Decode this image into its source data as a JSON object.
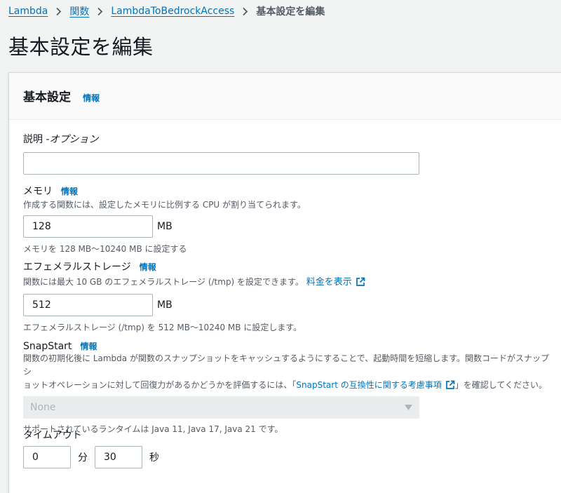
{
  "breadcrumb": {
    "items": [
      "Lambda",
      "関数",
      "LambdaToBedrockAccess"
    ],
    "current": "基本設定を編集"
  },
  "page_title": "基本設定を編集",
  "panel": {
    "title": "基本設定",
    "info": "情報"
  },
  "description_field": {
    "label": "説明 - ",
    "optional": "オプション",
    "value": ""
  },
  "memory": {
    "label": "メモリ",
    "info": "情報",
    "desc": "作成する関数には、設定したメモリに比例する CPU が割り当てられます。",
    "value": "128",
    "unit": "MB",
    "hint": "メモリを 128 MB〜10240 MB に設定する"
  },
  "ephemeral": {
    "label": "エフェメラルストレージ",
    "info": "情報",
    "desc": "関数には最大 10 GB のエフェメラルストレージ (/tmp) を設定できます。",
    "pricing_link": "料金を表示",
    "value": "512",
    "unit": "MB",
    "hint": "エフェメラルストレージ (/tmp) を 512 MB〜10240 MB に設定します。"
  },
  "snapstart": {
    "label": "SnapStart",
    "info": "情報",
    "desc_line1": "関数の初期化後に Lambda が関数のスナップショットをキャッシュするようにすることで、起動時間を短縮します。関数コードがスナップシ",
    "desc_line2_prefix": "ョットオペレーションに対して回復力があるかどうかを評価するには、「",
    "desc_link": "SnapStart の互換性に関する考慮事項",
    "desc_line2_suffix": "」を確認してください。",
    "selected": "None",
    "hint": "サポートされているランタイムは Java 11, Java 17, Java 21 です。"
  },
  "timeout": {
    "label": "タイムアウト",
    "minutes_value": "0",
    "minutes_unit": "分",
    "seconds_value": "30",
    "seconds_unit": "秒"
  },
  "colors": {
    "link": "#0073bb",
    "background": "#f2f3f3",
    "panel": "#ffffff",
    "text": "#16191f",
    "muted": "#545b64"
  }
}
